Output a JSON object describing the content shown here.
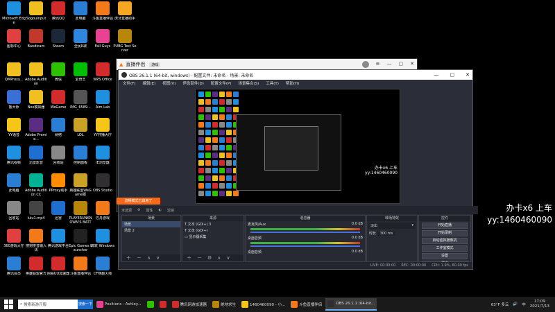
{
  "desktop_icons": [
    {
      "label": "Microsoft Edge",
      "color": "#1f8fe0",
      "icon": "edge-icon",
      "col": 0,
      "row": 0
    },
    {
      "label": "SogouInput",
      "color": "#f0c020",
      "icon": "folder-icon",
      "col": 1,
      "row": 0
    },
    {
      "label": "腾讯QQ",
      "color": "#d12b2b",
      "icon": "app-icon",
      "col": 2,
      "row": 0
    },
    {
      "label": "此电脑",
      "color": "#2a7fd4",
      "icon": "computer-icon",
      "col": 3,
      "row": 0
    },
    {
      "label": "斗鱼直播伴侣",
      "color": "#f27a1a",
      "icon": "app-icon",
      "col": 4,
      "row": 0
    },
    {
      "label": "虎牙直播助手",
      "color": "#f5a623",
      "icon": "app-icon",
      "col": 5,
      "row": 0
    },
    {
      "label": "图标中心",
      "color": "#e04040",
      "icon": "app-icon",
      "col": 0,
      "row": 1
    },
    {
      "label": "Bandicam",
      "color": "#c0392b",
      "icon": "record-icon",
      "col": 1,
      "row": 1
    },
    {
      "label": "Steam",
      "color": "#1b2838",
      "icon": "steam-icon",
      "col": 2,
      "row": 1
    },
    {
      "label": "全民K歌",
      "color": "#2e86de",
      "icon": "app-icon",
      "col": 3,
      "row": 1
    },
    {
      "label": "Fall Guys",
      "color": "#e84393",
      "icon": "game-icon",
      "col": 4,
      "row": 1
    },
    {
      "label": "PUBG Test Server",
      "color": "#b8860b",
      "icon": "game-icon",
      "col": 5,
      "row": 1
    },
    {
      "label": "QMProxy...",
      "color": "#f0c020",
      "icon": "file-icon",
      "col": 0,
      "row": 2
    },
    {
      "label": "Adobe Audition",
      "color": "#f0c020",
      "icon": "folder-icon",
      "col": 1,
      "row": 2
    },
    {
      "label": "微信",
      "color": "#2dc100",
      "icon": "wechat-icon",
      "col": 2,
      "row": 2
    },
    {
      "label": "爱奇艺",
      "color": "#00be06",
      "icon": "app-icon",
      "col": 3,
      "row": 2
    },
    {
      "label": "WPS Office",
      "color": "#d12b2b",
      "icon": "app-icon",
      "col": 4,
      "row": 2
    },
    {
      "label": "鲁大师",
      "color": "#3a6fd8",
      "icon": "app-icon",
      "col": 0,
      "row": 3
    },
    {
      "label": "Nox模拟器",
      "color": "#f0c020",
      "icon": "folder-icon",
      "col": 1,
      "row": 3
    },
    {
      "label": "WeGame",
      "color": "#d12b2b",
      "icon": "app-icon",
      "col": 2,
      "row": 3
    },
    {
      "label": "IMG_6589...",
      "color": "#555",
      "icon": "image-icon",
      "col": 3,
      "row": 3
    },
    {
      "label": "Aim Lab",
      "color": "#1f8fe0",
      "icon": "app-icon",
      "col": 4,
      "row": 3
    },
    {
      "label": "YY语音",
      "color": "#f5c518",
      "icon": "app-icon",
      "col": 0,
      "row": 4
    },
    {
      "label": "Adobe Premie...",
      "color": "#5a2d82",
      "icon": "premiere-icon",
      "col": 1,
      "row": 4
    },
    {
      "label": "网络",
      "color": "#2a7fd4",
      "icon": "network-icon",
      "col": 2,
      "row": 4
    },
    {
      "label": "LOL",
      "color": "#c9a227",
      "icon": "game-icon",
      "col": 3,
      "row": 4
    },
    {
      "label": "YY开播大厅",
      "color": "#f5c518",
      "icon": "app-icon",
      "col": 4,
      "row": 4
    },
    {
      "label": "腾讯视频",
      "color": "#1f8fe0",
      "icon": "app-icon",
      "col": 0,
      "row": 5
    },
    {
      "label": "迅雷影音",
      "color": "#1f6fd1",
      "icon": "app-icon",
      "col": 1,
      "row": 5
    },
    {
      "label": "回收站",
      "color": "#888",
      "icon": "recycle-bin-icon",
      "col": 2,
      "row": 5
    },
    {
      "label": "控制面板",
      "color": "#2a7fd4",
      "icon": "settings-icon",
      "col": 3,
      "row": 5
    },
    {
      "label": "IE浏览器",
      "color": "#1f8fe0",
      "icon": "ie-icon",
      "col": 4,
      "row": 5
    },
    {
      "label": "此电脑",
      "color": "#2a7fd4",
      "icon": "computer-icon",
      "col": 0,
      "row": 6
    },
    {
      "label": "Adobe Audition CC",
      "color": "#00b294",
      "icon": "audition-icon",
      "col": 1,
      "row": 6
    },
    {
      "label": "PProxy助手",
      "color": "#ff8c00",
      "icon": "app-icon",
      "col": 2,
      "row": 6
    },
    {
      "label": "英雄联盟WeGame版",
      "color": "#c9a227",
      "icon": "game-icon",
      "col": 3,
      "row": 6
    },
    {
      "label": "OBS Studio",
      "color": "#302e31",
      "icon": "obs-icon",
      "col": 4,
      "row": 6
    },
    {
      "label": "回收站",
      "color": "#888",
      "icon": "recycle-bin-icon",
      "col": 0,
      "row": 7
    },
    {
      "label": "lulu1.mp4",
      "color": "#444",
      "icon": "video-icon",
      "col": 1,
      "row": 7
    },
    {
      "label": "迅雷",
      "color": "#1f6fd1",
      "icon": "app-icon",
      "col": 2,
      "row": 7
    },
    {
      "label": "PLAYERUNKNOWN'S BATTLEGR...",
      "color": "#b8860b",
      "icon": "game-icon",
      "col": 3,
      "row": 7
    },
    {
      "label": "方舟游戏",
      "color": "#f27a1a",
      "icon": "app-icon",
      "col": 4,
      "row": 7
    },
    {
      "label": "360游戏大厅",
      "color": "#e04040",
      "icon": "app-icon",
      "col": 0,
      "row": 8
    },
    {
      "label": "搜狗拼音输入法",
      "color": "#f27a1a",
      "icon": "app-icon",
      "col": 1,
      "row": 8
    },
    {
      "label": "腾讯游戏平台",
      "color": "#1f8fe0",
      "icon": "app-icon",
      "col": 2,
      "row": 8
    },
    {
      "label": "Epic Games Launcher",
      "color": "#222",
      "icon": "epic-icon",
      "col": 3,
      "row": 8
    },
    {
      "label": "微软 Windows",
      "color": "#1f8fe0",
      "icon": "windows-icon",
      "col": 4,
      "row": 8
    },
    {
      "label": "腾讯会员",
      "color": "#2a7fd4",
      "icon": "app-icon",
      "col": 0,
      "row": 9
    },
    {
      "label": "英雄联盟官方",
      "color": "#d12b2b",
      "icon": "app-icon",
      "col": 1,
      "row": 9
    },
    {
      "label": "网易UU加速器",
      "color": "#d12b2b",
      "icon": "app-icon",
      "col": 2,
      "row": 9
    },
    {
      "label": "斗鱼直播伴侣",
      "color": "#f27a1a",
      "icon": "app-icon",
      "col": 3,
      "row": 9
    },
    {
      "label": "CF穿越火线",
      "color": "#2a7fd4",
      "icon": "app-icon",
      "col": 4,
      "row": 9
    }
  ],
  "huya_window": {
    "title": "直播伴侣",
    "badge": "游戏",
    "side_label": "工具"
  },
  "obs": {
    "title": "OBS 26.1.1 (64-bit, windows) - 配置文件: 未命名 - 场景: 未命名",
    "menu": [
      "文件(F)",
      "编辑(E)",
      "视图(V)",
      "停靠部件(D)",
      "配置文件(P)",
      "场景集合(S)",
      "工具(T)",
      "帮助(H)"
    ],
    "preview_overlay": [
      "办卡x6 上车",
      "yy:1460460090"
    ],
    "scene_bar": [
      "未选源",
      "属性",
      "滤镜"
    ],
    "docks": {
      "scenes": {
        "header": "场景",
        "items": [
          "场景",
          "场景 2"
        ]
      },
      "sources": {
        "header": "来源",
        "items": [
          "文本 (GDI+) 3",
          "文本 (GDI+)",
          "显示器采集"
        ]
      },
      "mixer": {
        "header": "混音器",
        "channels": [
          {
            "name": "麦克风/Aux",
            "db": "0.0 dB"
          },
          {
            "name": "桌面音频",
            "db": "0.0 dB"
          },
          {
            "name": "桌面音频",
            "db": "0.0 dB"
          }
        ]
      },
      "transitions": {
        "header": "转场特效",
        "type": "淡出",
        "duration_label": "时长",
        "duration": "300 ms"
      },
      "controls": {
        "header": "控件",
        "buttons": [
          "开始直播",
          "开始录制",
          "启动虚拟摄像机",
          "工作室模式",
          "设置",
          "退出"
        ]
      }
    },
    "status": [
      "LIVE: 00:00:00",
      "REC: 00:00:00",
      "CPU: 1.9%, 60.00 fps"
    ]
  },
  "orange_tip": "流畅模式已启用了",
  "overlay_text": [
    "办卡x6 上车",
    "yy:1460460090"
  ],
  "taskbar": {
    "search_placeholder": "搜索新游开服",
    "search_button": "搜索一下",
    "items": [
      {
        "label": "Positions - Ashley...",
        "color": "#e84393"
      },
      {
        "label": "",
        "color": "#2dc100"
      },
      {
        "label": "",
        "color": "#d12b2b"
      },
      {
        "label": "腾讯网游加速器",
        "color": "#d12b2b"
      },
      {
        "label": "绝地求生",
        "color": "#b8860b"
      },
      {
        "label": "1460460090 - 小...",
        "color": "#f5c518"
      },
      {
        "label": "斗鱼直播伴侣",
        "color": "#f27a1a"
      },
      {
        "label": "OBS 26.1.1 (64-bit...",
        "color": "#302e31",
        "active": true
      }
    ],
    "weather": "63°F 多云",
    "ime": "中",
    "time": "17:09",
    "date": "2021/7/13"
  }
}
